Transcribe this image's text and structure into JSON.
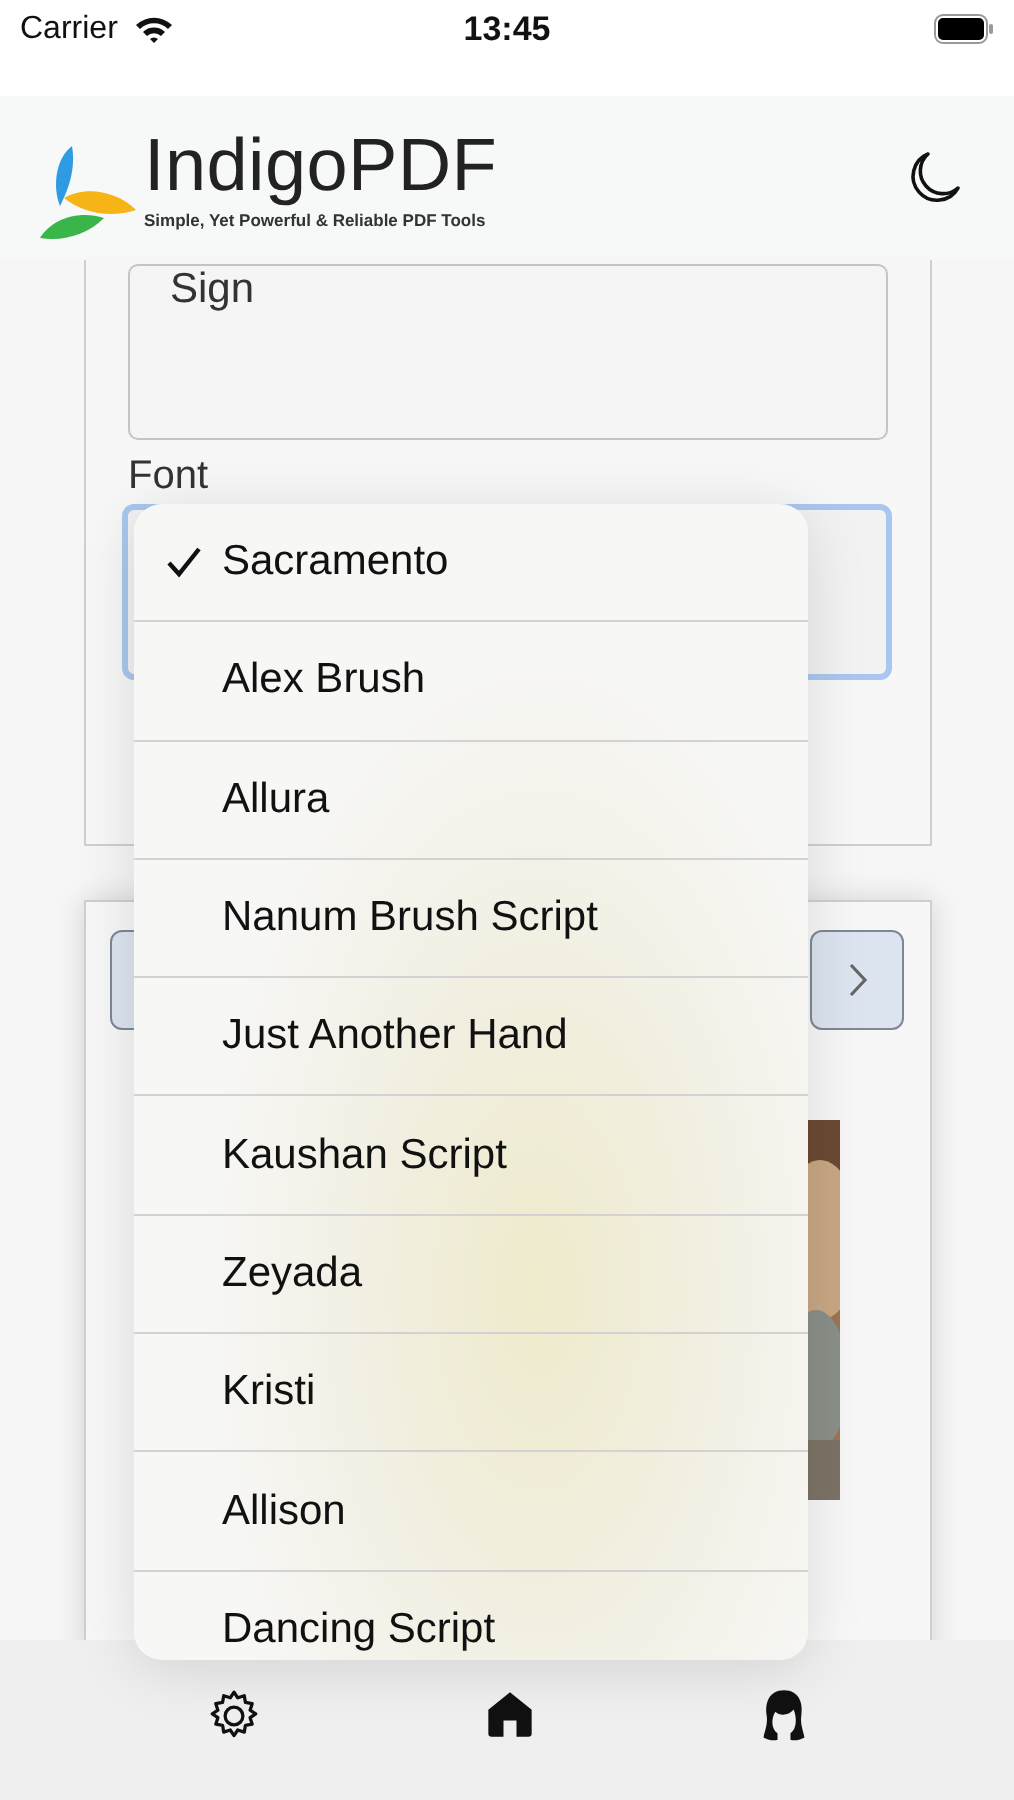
{
  "status_bar": {
    "carrier": "Carrier",
    "time": "13:45"
  },
  "header": {
    "brand": "IndigoPDF",
    "tagline": "Simple, Yet Powerful & Reliable PDF Tools"
  },
  "sign_field": {
    "value": "Sign"
  },
  "font_field": {
    "label": "Font"
  },
  "font_menu": {
    "items": [
      {
        "label": "Sacramento",
        "selected": true
      },
      {
        "label": "Alex Brush",
        "selected": false
      },
      {
        "label": "Allura",
        "selected": false
      },
      {
        "label": "Nanum Brush Script",
        "selected": false
      },
      {
        "label": "Just Another Hand",
        "selected": false
      },
      {
        "label": "Kaushan Script",
        "selected": false
      },
      {
        "label": "Zeyada",
        "selected": false
      },
      {
        "label": "Kristi",
        "selected": false
      },
      {
        "label": "Allison",
        "selected": false
      },
      {
        "label": "Dancing Script",
        "selected": false
      }
    ]
  }
}
